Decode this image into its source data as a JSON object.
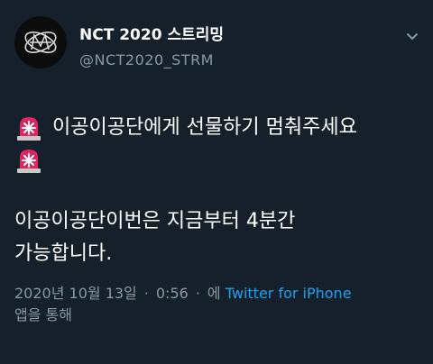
{
  "author": {
    "display_name": "NCT 2020 스트리밍",
    "handle": "@NCT2020_STRM",
    "avatar_icon": "nct-logo-icon"
  },
  "tweet": {
    "line1_text": "이공이공단에게 선물하기 멈춰주세요",
    "line2_text": "",
    "para2_line1": "이공이공단이번은 지금부터 4분간",
    "para2_line2": "가능합니다.",
    "siren_icon": "police-car-light-icon"
  },
  "meta": {
    "timestamp": "2020년 10월 13일",
    "time": "0:56",
    "via_prefix": "에",
    "source": "Twitter for iPhone",
    "suffix": "앱을 통해"
  },
  "menu": {
    "caret_icon": "chevron-down-icon"
  },
  "colors": {
    "background": "#15202b",
    "primary_text": "#ffffff",
    "secondary_text": "#8899a6",
    "link": "#1da1f2"
  }
}
